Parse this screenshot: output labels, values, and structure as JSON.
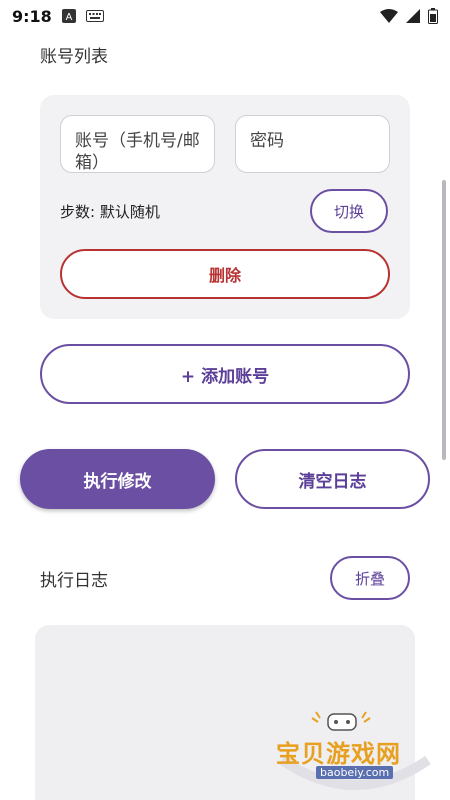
{
  "status_bar": {
    "time": "9:18"
  },
  "account_list": {
    "title": "账号列表",
    "account_placeholder": "账号（手机号/邮箱）",
    "password_placeholder": "密码",
    "steps_label": "步数: 默认随机",
    "switch_label": "切换",
    "delete_label": "删除"
  },
  "add_account_label": "+ 添加账号",
  "actions": {
    "execute_label": "执行修改",
    "clear_log_label": "清空日志"
  },
  "log": {
    "title": "执行日志",
    "collapse_label": "折叠"
  },
  "watermark": {
    "text": "宝贝游戏网",
    "url": "baobeiy.com"
  },
  "colors": {
    "accent": "#6a4fa3",
    "danger": "#b83232",
    "card_bg": "#f2f2f4"
  }
}
